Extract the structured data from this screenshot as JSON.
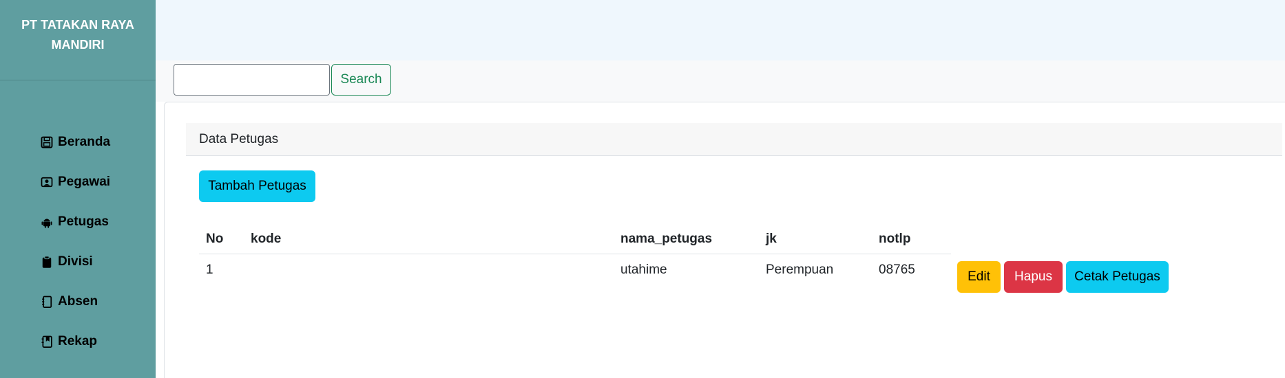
{
  "sidebar": {
    "brand": "PT TATAKAN RAYA MANDIRI",
    "items": [
      {
        "label": "Beranda",
        "icon": "floppy-disk-icon"
      },
      {
        "label": "Pegawai",
        "icon": "person-badge-icon"
      },
      {
        "label": "Petugas",
        "icon": "android-icon"
      },
      {
        "label": "Divisi",
        "icon": "clipboard-icon"
      },
      {
        "label": "Absen",
        "icon": "journal-icon"
      },
      {
        "label": "Rekap",
        "icon": "bookmark-book-icon"
      }
    ]
  },
  "search": {
    "value": "",
    "button_label": "Search"
  },
  "card": {
    "title": "Data Petugas",
    "add_label": "Tambah Petugas"
  },
  "table": {
    "headers": [
      "No",
      "kode",
      "nama_petugas",
      "jk",
      "notlp"
    ],
    "rows": [
      {
        "no": "1",
        "kode": "",
        "nama_petugas": "utahime",
        "jk": "Perempuan",
        "notlp": "08765"
      }
    ],
    "actions": {
      "edit": "Edit",
      "hapus": "Hapus",
      "cetak": "Cetak Petugas"
    }
  },
  "colors": {
    "sidebar": "#5f9ea0",
    "topbar": "#eff7fd",
    "info": "#0dcaf0",
    "warning": "#ffc107",
    "danger": "#dc3545",
    "success": "#198754"
  }
}
